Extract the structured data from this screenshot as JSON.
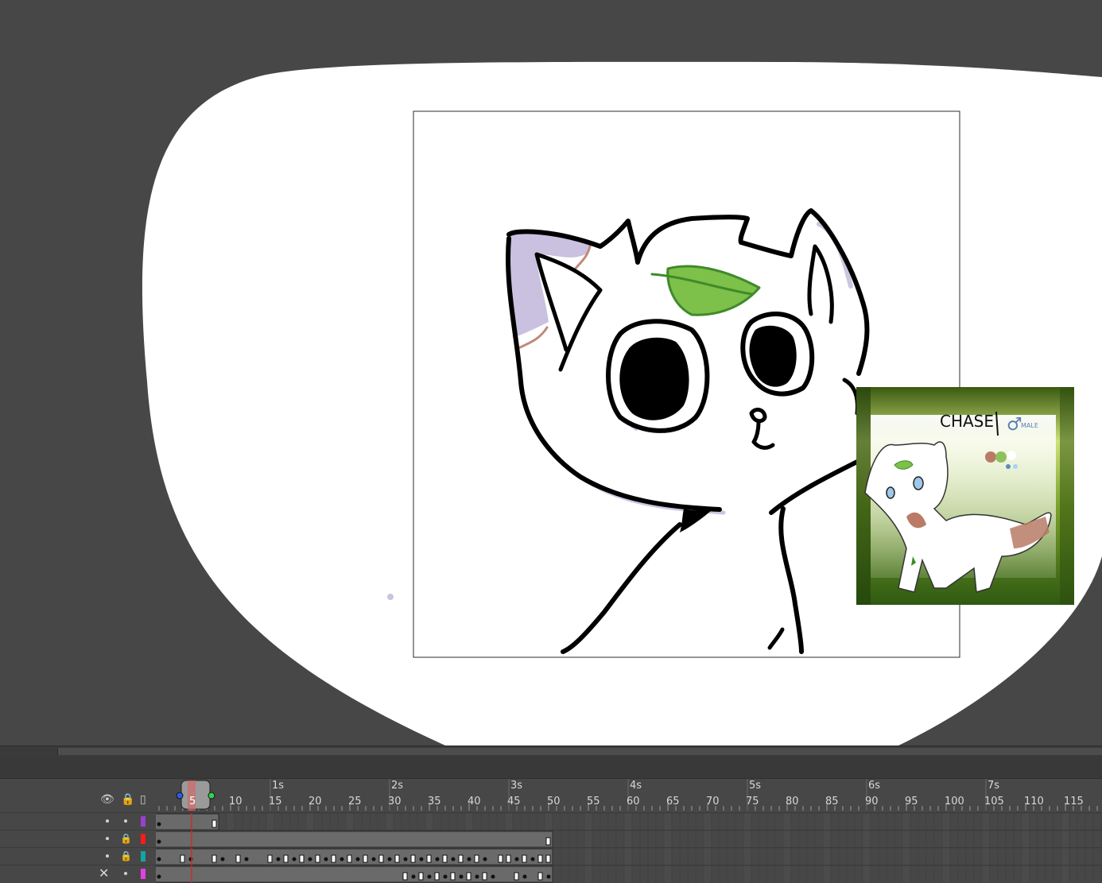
{
  "stage": {
    "reference_image": {
      "character_name": "CHASE",
      "gender_label": "MALE",
      "gender_symbol": "♂",
      "palette_colors": [
        "#b97b66",
        "#8fbf5f",
        "#ffffff",
        "#5b8db8",
        "#a9d4ef"
      ]
    },
    "colors": {
      "outline": "#000000",
      "ear_fill": "#c9c1df",
      "ear_edge": "#c08a78",
      "leaf": "#7dc04a",
      "leaf_edge": "#3f8a2a",
      "shadow": "#c9c6e0"
    }
  },
  "timeline": {
    "seconds": [
      "1s",
      "2s",
      "3s",
      "4s",
      "5s",
      "6s",
      "7s"
    ],
    "frames": [
      "5",
      "10",
      "15",
      "20",
      "25",
      "30",
      "35",
      "40",
      "45",
      "50",
      "55",
      "60",
      "65",
      "70",
      "75",
      "80",
      "85",
      "90",
      "95",
      "100",
      "105",
      "110",
      "115"
    ],
    "current_frame": "5",
    "header_icons": [
      "eye-icon",
      "lock-icon",
      "outline-icon"
    ],
    "layers": [
      {
        "color": "#9b3fcf",
        "locked": false,
        "hidden": false
      },
      {
        "color": "#ff1a1a",
        "locked": true,
        "hidden": false
      },
      {
        "color": "#16a3a3",
        "locked": true,
        "hidden": false
      },
      {
        "color": "#e43fe4",
        "locked": false,
        "hidden": true
      }
    ]
  }
}
